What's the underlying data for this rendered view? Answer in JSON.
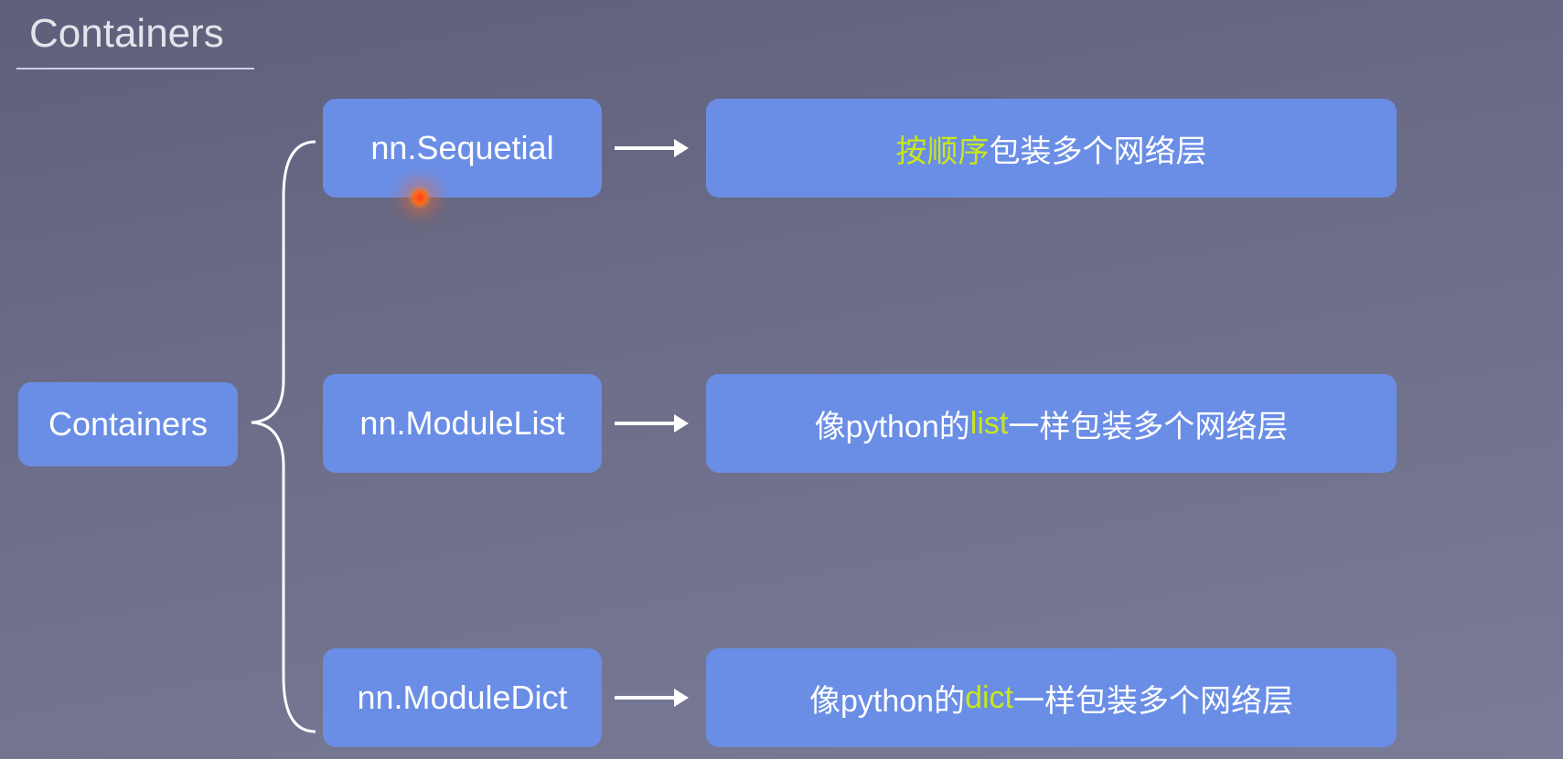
{
  "title": "Containers",
  "root": {
    "label": "Containers"
  },
  "nodes": [
    {
      "name": "nn.Sequetial",
      "desc_parts": [
        "",
        "按顺序",
        "包装多个网络层"
      ]
    },
    {
      "name": "nn.ModuleList",
      "desc_parts": [
        "像python的",
        "list",
        "一样包装多个网络层"
      ]
    },
    {
      "name": "nn.ModuleDict",
      "desc_parts": [
        "像python的",
        "dict",
        "一样包装多个网络层"
      ]
    }
  ]
}
